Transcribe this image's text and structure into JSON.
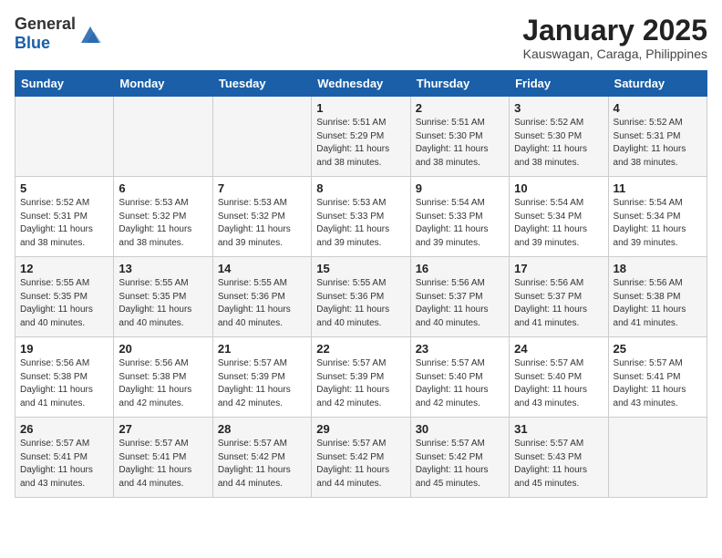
{
  "header": {
    "logo_general": "General",
    "logo_blue": "Blue",
    "title": "January 2025",
    "subtitle": "Kauswagan, Caraga, Philippines"
  },
  "days_of_week": [
    "Sunday",
    "Monday",
    "Tuesday",
    "Wednesday",
    "Thursday",
    "Friday",
    "Saturday"
  ],
  "weeks": [
    [
      {
        "day": "",
        "info": ""
      },
      {
        "day": "",
        "info": ""
      },
      {
        "day": "",
        "info": ""
      },
      {
        "day": "1",
        "info": "Sunrise: 5:51 AM\nSunset: 5:29 PM\nDaylight: 11 hours\nand 38 minutes."
      },
      {
        "day": "2",
        "info": "Sunrise: 5:51 AM\nSunset: 5:30 PM\nDaylight: 11 hours\nand 38 minutes."
      },
      {
        "day": "3",
        "info": "Sunrise: 5:52 AM\nSunset: 5:30 PM\nDaylight: 11 hours\nand 38 minutes."
      },
      {
        "day": "4",
        "info": "Sunrise: 5:52 AM\nSunset: 5:31 PM\nDaylight: 11 hours\nand 38 minutes."
      }
    ],
    [
      {
        "day": "5",
        "info": "Sunrise: 5:52 AM\nSunset: 5:31 PM\nDaylight: 11 hours\nand 38 minutes."
      },
      {
        "day": "6",
        "info": "Sunrise: 5:53 AM\nSunset: 5:32 PM\nDaylight: 11 hours\nand 38 minutes."
      },
      {
        "day": "7",
        "info": "Sunrise: 5:53 AM\nSunset: 5:32 PM\nDaylight: 11 hours\nand 39 minutes."
      },
      {
        "day": "8",
        "info": "Sunrise: 5:53 AM\nSunset: 5:33 PM\nDaylight: 11 hours\nand 39 minutes."
      },
      {
        "day": "9",
        "info": "Sunrise: 5:54 AM\nSunset: 5:33 PM\nDaylight: 11 hours\nand 39 minutes."
      },
      {
        "day": "10",
        "info": "Sunrise: 5:54 AM\nSunset: 5:34 PM\nDaylight: 11 hours\nand 39 minutes."
      },
      {
        "day": "11",
        "info": "Sunrise: 5:54 AM\nSunset: 5:34 PM\nDaylight: 11 hours\nand 39 minutes."
      }
    ],
    [
      {
        "day": "12",
        "info": "Sunrise: 5:55 AM\nSunset: 5:35 PM\nDaylight: 11 hours\nand 40 minutes."
      },
      {
        "day": "13",
        "info": "Sunrise: 5:55 AM\nSunset: 5:35 PM\nDaylight: 11 hours\nand 40 minutes."
      },
      {
        "day": "14",
        "info": "Sunrise: 5:55 AM\nSunset: 5:36 PM\nDaylight: 11 hours\nand 40 minutes."
      },
      {
        "day": "15",
        "info": "Sunrise: 5:55 AM\nSunset: 5:36 PM\nDaylight: 11 hours\nand 40 minutes."
      },
      {
        "day": "16",
        "info": "Sunrise: 5:56 AM\nSunset: 5:37 PM\nDaylight: 11 hours\nand 40 minutes."
      },
      {
        "day": "17",
        "info": "Sunrise: 5:56 AM\nSunset: 5:37 PM\nDaylight: 11 hours\nand 41 minutes."
      },
      {
        "day": "18",
        "info": "Sunrise: 5:56 AM\nSunset: 5:38 PM\nDaylight: 11 hours\nand 41 minutes."
      }
    ],
    [
      {
        "day": "19",
        "info": "Sunrise: 5:56 AM\nSunset: 5:38 PM\nDaylight: 11 hours\nand 41 minutes."
      },
      {
        "day": "20",
        "info": "Sunrise: 5:56 AM\nSunset: 5:38 PM\nDaylight: 11 hours\nand 42 minutes."
      },
      {
        "day": "21",
        "info": "Sunrise: 5:57 AM\nSunset: 5:39 PM\nDaylight: 11 hours\nand 42 minutes."
      },
      {
        "day": "22",
        "info": "Sunrise: 5:57 AM\nSunset: 5:39 PM\nDaylight: 11 hours\nand 42 minutes."
      },
      {
        "day": "23",
        "info": "Sunrise: 5:57 AM\nSunset: 5:40 PM\nDaylight: 11 hours\nand 42 minutes."
      },
      {
        "day": "24",
        "info": "Sunrise: 5:57 AM\nSunset: 5:40 PM\nDaylight: 11 hours\nand 43 minutes."
      },
      {
        "day": "25",
        "info": "Sunrise: 5:57 AM\nSunset: 5:41 PM\nDaylight: 11 hours\nand 43 minutes."
      }
    ],
    [
      {
        "day": "26",
        "info": "Sunrise: 5:57 AM\nSunset: 5:41 PM\nDaylight: 11 hours\nand 43 minutes."
      },
      {
        "day": "27",
        "info": "Sunrise: 5:57 AM\nSunset: 5:41 PM\nDaylight: 11 hours\nand 44 minutes."
      },
      {
        "day": "28",
        "info": "Sunrise: 5:57 AM\nSunset: 5:42 PM\nDaylight: 11 hours\nand 44 minutes."
      },
      {
        "day": "29",
        "info": "Sunrise: 5:57 AM\nSunset: 5:42 PM\nDaylight: 11 hours\nand 44 minutes."
      },
      {
        "day": "30",
        "info": "Sunrise: 5:57 AM\nSunset: 5:42 PM\nDaylight: 11 hours\nand 45 minutes."
      },
      {
        "day": "31",
        "info": "Sunrise: 5:57 AM\nSunset: 5:43 PM\nDaylight: 11 hours\nand 45 minutes."
      },
      {
        "day": "",
        "info": ""
      }
    ]
  ]
}
